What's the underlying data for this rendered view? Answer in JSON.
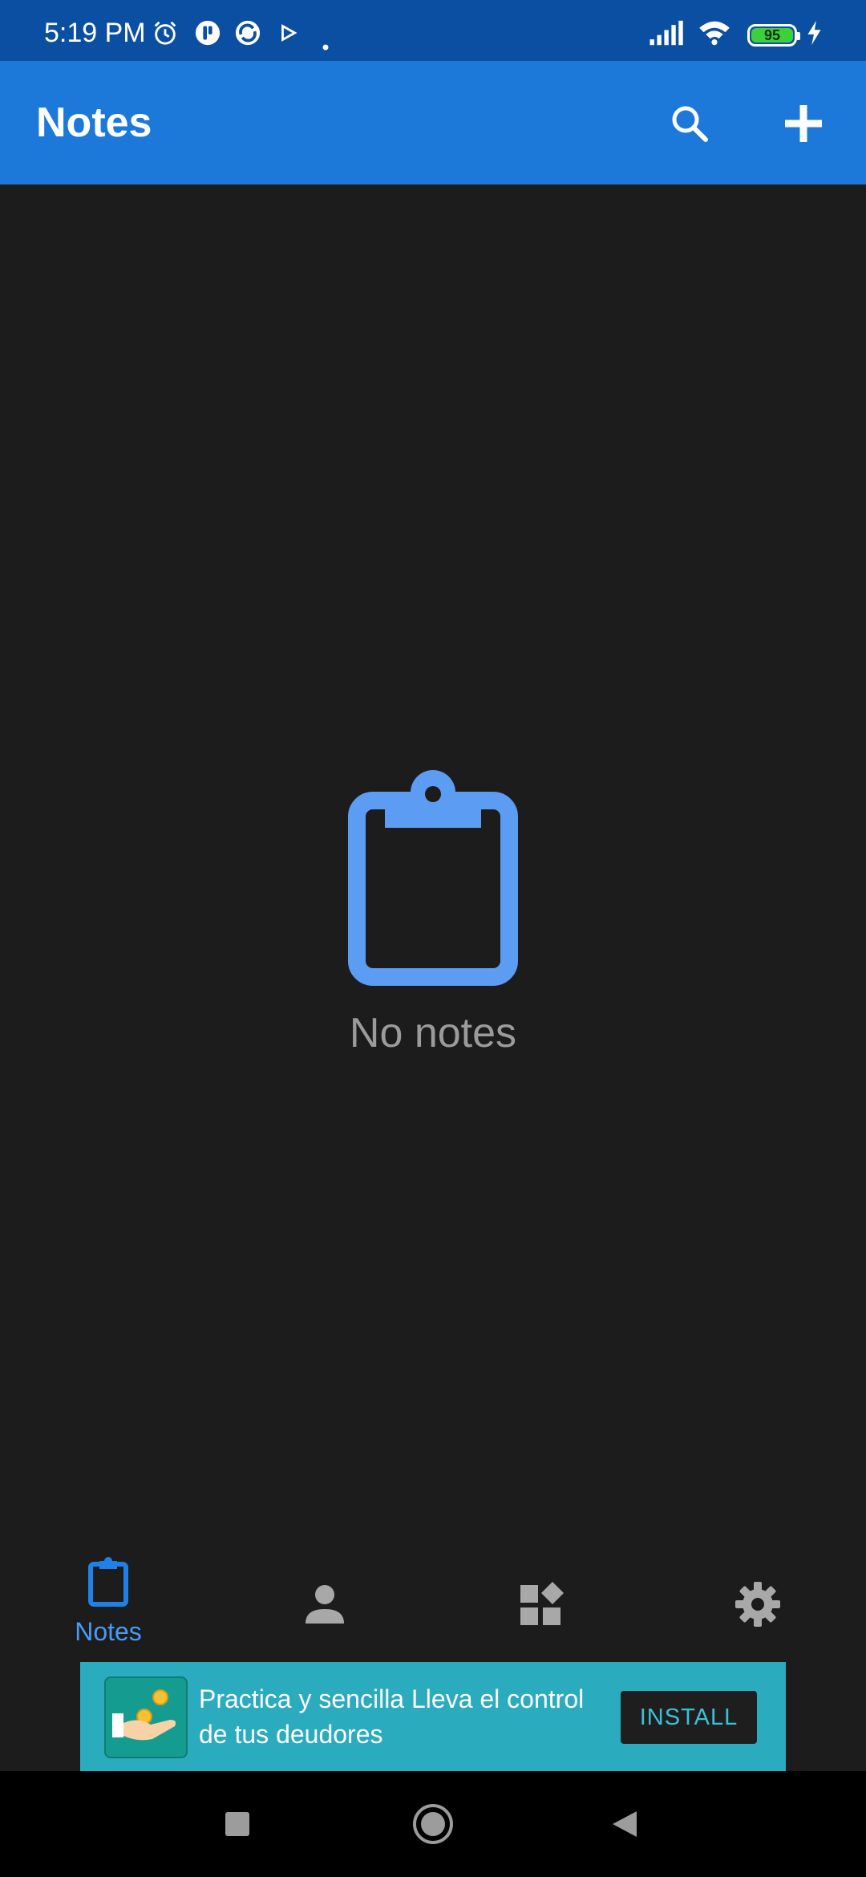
{
  "status_bar": {
    "time": "5:19 PM",
    "battery_level": "95",
    "icons": [
      "alarm-icon",
      "app-notification-icon",
      "sync-icon",
      "play-icon",
      "dot-icon",
      "signal-icon",
      "wifi-icon",
      "battery-icon",
      "charging-icon"
    ]
  },
  "app_bar": {
    "title": "Notes",
    "actions": [
      "search-icon",
      "add-icon"
    ]
  },
  "empty_state": {
    "icon": "clipboard-icon",
    "text": "No notes"
  },
  "bottom_nav": {
    "items": [
      {
        "id": "notes",
        "label": "Notes",
        "icon": "clipboard-icon",
        "active": true
      },
      {
        "id": "contacts",
        "label": "",
        "icon": "person-icon",
        "active": false
      },
      {
        "id": "widgets",
        "label": "",
        "icon": "widgets-icon",
        "active": false
      },
      {
        "id": "settings",
        "label": "",
        "icon": "gear-icon",
        "active": false
      }
    ]
  },
  "ad": {
    "text": "Practica y sencilla Lleva el control de tus deudores",
    "button_label": "INSTALL"
  },
  "system_nav": {
    "buttons": [
      "recents-icon",
      "home-icon",
      "back-icon"
    ]
  },
  "colors": {
    "status_bar": "#0b4fa3",
    "app_bar": "#1c79d9",
    "accent": "#4a9af4",
    "background": "#1c1c1d",
    "ad_banner": "#2aabbe"
  }
}
